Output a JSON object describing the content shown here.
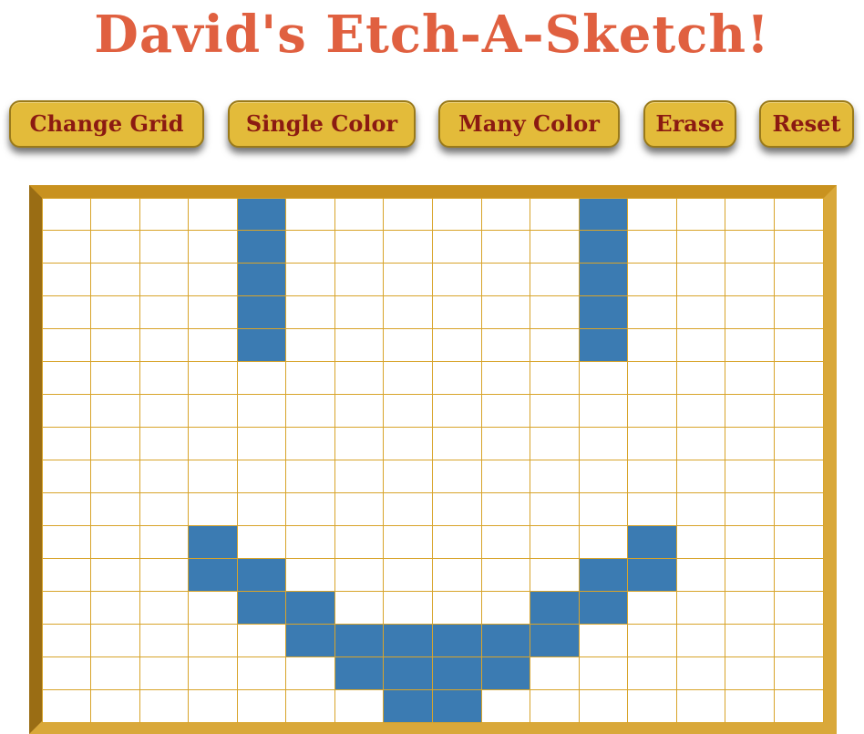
{
  "app": {
    "title": "David's Etch-A-Sketch!"
  },
  "toolbar": {
    "change_grid_label": "Change Grid",
    "single_color_label": "Single Color",
    "many_color_label": "Many Color",
    "erase_label": "Erase",
    "reset_label": "Reset"
  },
  "colors": {
    "title": "#e06040",
    "button_bg": "#e3bb3a",
    "button_text": "#8b1a12",
    "grid_line": "#d8a42a",
    "cell_empty": "#ffffff",
    "cell_filled": "#3b7bb2",
    "frame": "#c9921f"
  },
  "grid": {
    "rows": 16,
    "cols": 16,
    "filled_cells": [
      [
        0,
        4
      ],
      [
        1,
        4
      ],
      [
        2,
        4
      ],
      [
        3,
        4
      ],
      [
        4,
        4
      ],
      [
        0,
        11
      ],
      [
        1,
        11
      ],
      [
        2,
        11
      ],
      [
        3,
        11
      ],
      [
        4,
        11
      ],
      [
        10,
        3
      ],
      [
        11,
        3
      ],
      [
        11,
        4
      ],
      [
        12,
        4
      ],
      [
        12,
        5
      ],
      [
        13,
        5
      ],
      [
        13,
        6
      ],
      [
        13,
        7
      ],
      [
        13,
        8
      ],
      [
        13,
        9
      ],
      [
        13,
        10
      ],
      [
        14,
        6
      ],
      [
        14,
        7
      ],
      [
        14,
        8
      ],
      [
        14,
        9
      ],
      [
        15,
        7
      ],
      [
        15,
        8
      ],
      [
        10,
        12
      ],
      [
        11,
        11
      ],
      [
        11,
        12
      ],
      [
        12,
        10
      ],
      [
        12,
        11
      ]
    ]
  }
}
